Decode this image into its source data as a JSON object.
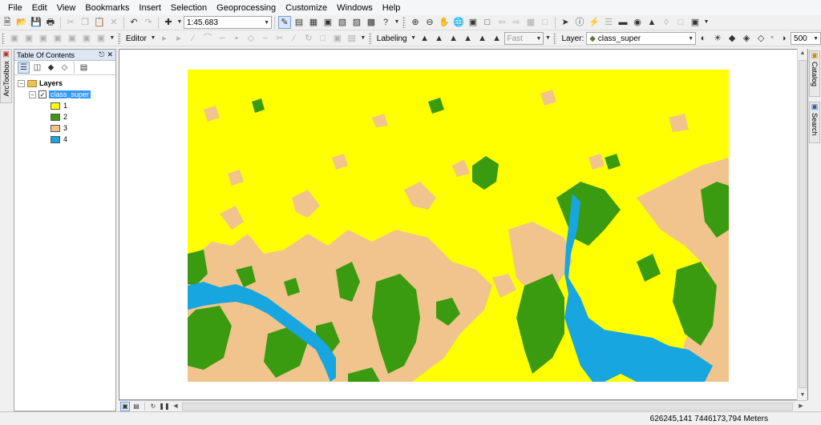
{
  "menu": [
    "File",
    "Edit",
    "View",
    "Bookmarks",
    "Insert",
    "Selection",
    "Geoprocessing",
    "Customize",
    "Windows",
    "Help"
  ],
  "toolbar_standard": {
    "scale_value": "1:45.683"
  },
  "toolbar_second": {
    "editor_label": "Editor",
    "labeling_label": "Labeling",
    "fast_value": "Fast",
    "layer_label": "Layer:",
    "layer_value": "class_super",
    "size_value": "500"
  },
  "arctoolbox_label": "ArcToolbox",
  "toc": {
    "title": "Table Of Contents",
    "pin": "↕ ×",
    "layers_label": "Layers",
    "layer_name": "class_super",
    "classes": [
      {
        "label": "1",
        "color": "#ffff00"
      },
      {
        "label": "2",
        "color": "#3a9b10"
      },
      {
        "label": "3",
        "color": "#f0c48c"
      },
      {
        "label": "4",
        "color": "#17a6e0"
      }
    ]
  },
  "right_tabs": {
    "catalog": "Catalog",
    "search": "Search"
  },
  "status": {
    "coordinates": "626245,141  7446173,794 Meters"
  },
  "colors": {
    "class1": "#ffff00",
    "class2": "#3a9b10",
    "class3": "#f0c48c",
    "class4": "#17a6e0"
  }
}
